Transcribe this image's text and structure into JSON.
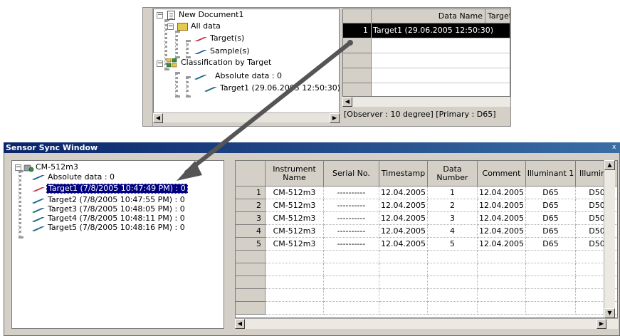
{
  "top": {
    "tree": {
      "root": "New Document1",
      "all_data": "All data",
      "targets": "Target(s)",
      "samples": "Sample(s)",
      "classification": "Classification by Target",
      "absolute": "Absolute data : 0",
      "target1": "Target1 (29.06.2005 12:50:30) : 0"
    },
    "grid": {
      "headers": [
        "Data Name",
        "Target"
      ],
      "rows": [
        {
          "num": "1",
          "name": "Target1 (29.06.2005 12:50:30)"
        }
      ],
      "selected_row": 1
    },
    "status": "[Observer : 10 degree]  [Primary : D65]"
  },
  "sensor_window": {
    "title": "Sensor Sync Window",
    "close_glyph": "x",
    "tree": {
      "root": "CM-512m3",
      "absolute": "Absolute data : 0",
      "items": [
        "Target1 (7/8/2005 10:47:49 PM) : 0",
        "Target2 (7/8/2005 10:47:55 PM) : 0",
        "Target3 (7/8/2005 10:48:05 PM) : 0",
        "Target4 (7/8/2005 10:48:11 PM) : 0",
        "Target5 (7/8/2005 10:48:16 PM) : 0"
      ],
      "selected_index": 0
    },
    "grid": {
      "headers": [
        "Instrument Name",
        "Serial No.",
        "Timestamp",
        "Data Number",
        "Comment",
        "Illuminant 1",
        "Illumina"
      ],
      "rows": [
        {
          "num": "1",
          "cells": [
            "CM-512m3",
            "----------",
            "12.04.2005",
            "1",
            "12.04.2005",
            "D65",
            "D50"
          ]
        },
        {
          "num": "2",
          "cells": [
            "CM-512m3",
            "----------",
            "12.04.2005",
            "2",
            "12.04.2005",
            "D65",
            "D50"
          ]
        },
        {
          "num": "3",
          "cells": [
            "CM-512m3",
            "----------",
            "12.04.2005",
            "3",
            "12.04.2005",
            "D65",
            "D50"
          ]
        },
        {
          "num": "4",
          "cells": [
            "CM-512m3",
            "----------",
            "12.04.2005",
            "4",
            "12.04.2005",
            "D65",
            "D50"
          ]
        },
        {
          "num": "5",
          "cells": [
            "CM-512m3",
            "----------",
            "12.04.2005",
            "5",
            "12.04.2005",
            "D65",
            "D50"
          ]
        }
      ],
      "empty_rows": 5
    }
  },
  "colors": {
    "target_pen": "#c8304a",
    "sample_pen": "#2a5aa8",
    "green_pen": "#1f8a5a",
    "selection": "#000080",
    "arrow": "#555555"
  }
}
